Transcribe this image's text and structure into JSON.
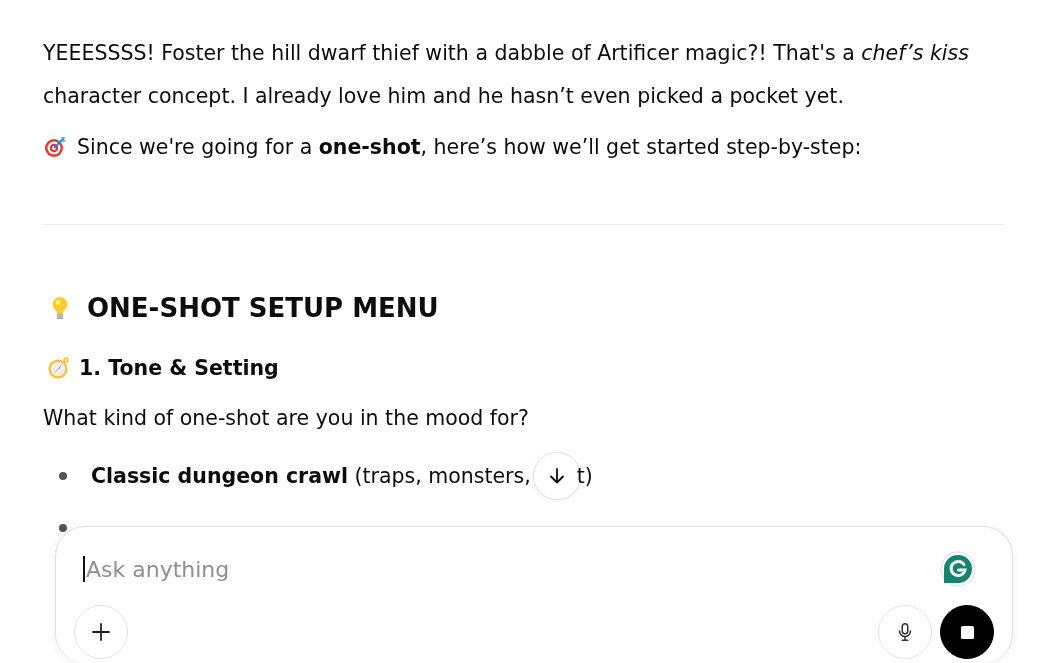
{
  "message": {
    "paragraphs": [
      {
        "text": "YEEESSSS! Foster the hill dwarf thief with a dabble of Artificer magic?! That's a *chef’s kiss* character concept. I already love him and he hasn’t even picked a pocket yet."
      },
      {
        "text": "Since we're going for a **one-shot**, here’s how we’ll get started step-by-step:"
      }
    ],
    "heading": {
      "text": "ONE-SHOT SETUP MENU"
    },
    "subheading": {
      "text": "1. Tone & Setting"
    },
    "question": "What kind of one-shot are you in the mood for?",
    "list": [
      {
        "kind": "text",
        "text": "**Classic dungeon crawl** (traps, monsters,",
        "after_cover": "t)"
      },
      {
        "kind": "covered"
      }
    ]
  },
  "composer": {
    "placeholder": "Ask anything"
  }
}
